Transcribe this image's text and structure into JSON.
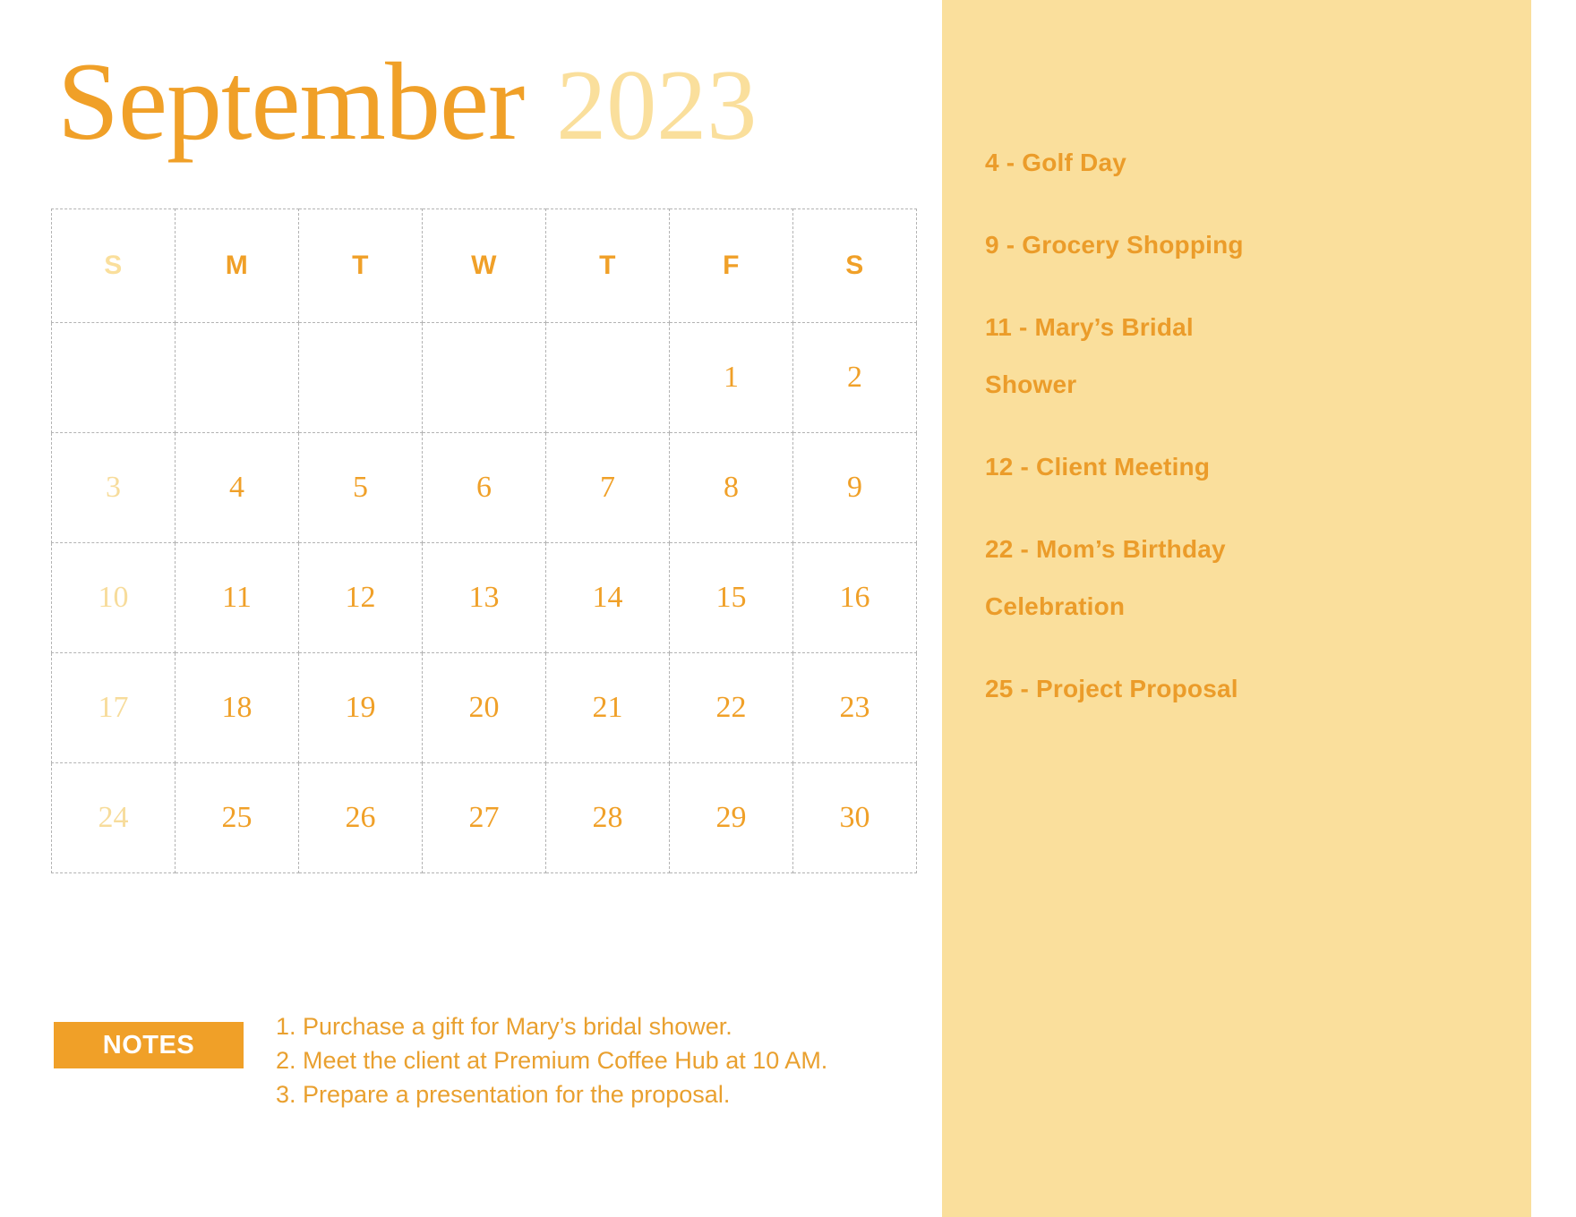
{
  "title": {
    "month": "September",
    "year": "2023"
  },
  "colors": {
    "accent": "#F0A028",
    "accent_light": "#FADF9C",
    "sidebar_bg": "#FADF9C",
    "grid_line": "#B3B3B3",
    "sunday_text": "#F7DC9B",
    "notes_badge_bg": "#F0A028",
    "notes_badge_text": "#FFFFFF"
  },
  "calendar": {
    "weekday_headers": [
      "S",
      "M",
      "T",
      "W",
      "T",
      "F",
      "S"
    ],
    "weeks": [
      [
        "",
        "",
        "",
        "",
        "",
        "1",
        "2"
      ],
      [
        "3",
        "4",
        "5",
        "6",
        "7",
        "8",
        "9"
      ],
      [
        "10",
        "11",
        "12",
        "13",
        "14",
        "15",
        "16"
      ],
      [
        "17",
        "18",
        "19",
        "20",
        "21",
        "22",
        "23"
      ],
      [
        "24",
        "25",
        "26",
        "27",
        "28",
        "29",
        "30"
      ]
    ]
  },
  "notes": {
    "badge_label": "NOTES",
    "items": [
      "1. Purchase a gift for Mary’s bridal shower.",
      "2. Meet the client at Premium Coffee Hub at 10 AM.",
      "3. Prepare a presentation for the proposal."
    ]
  },
  "sidebar": {
    "events": [
      "4 - Golf Day",
      "9 - Grocery Shopping",
      "11 - Mary’s Bridal Shower",
      "12 - Client Meeting",
      "22 - Mom’s Birthday Celebration",
      "25 - Project Proposal"
    ]
  }
}
